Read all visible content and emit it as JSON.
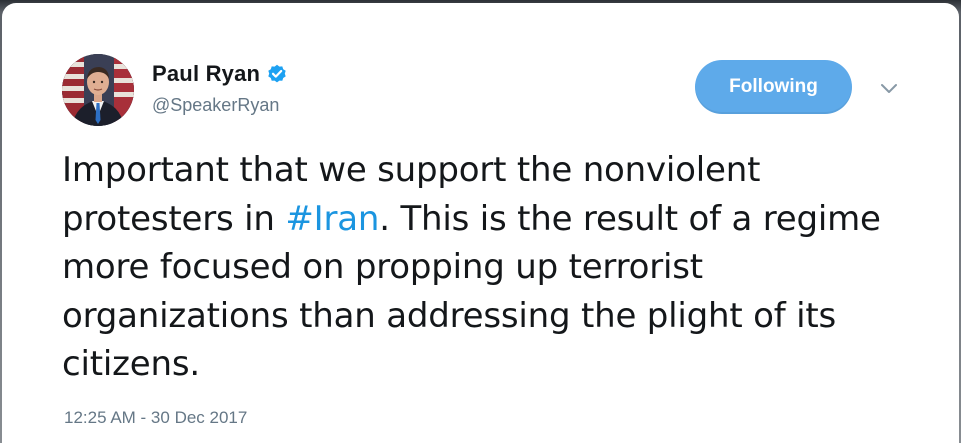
{
  "tweet": {
    "author": {
      "display_name": "Paul Ryan",
      "handle": "@SpeakerRyan",
      "verified": true,
      "avatar_icon": "profile-photo"
    },
    "follow_button_label": "Following",
    "menu_icon": "chevron-down-icon",
    "text_before_hashtag": "Important that we support the nonviolent protesters in ",
    "hashtag": "#Iran",
    "text_after_hashtag": ". This is the result of a regime more focused on propping up terrorist organizations than addressing the plight of its citizens.",
    "timestamp": "12:25 AM - 30 Dec 2017"
  },
  "colors": {
    "accent": "#1b95e0",
    "button_bg": "#5eaaea",
    "secondary_text": "#657786",
    "primary_text": "#14171a"
  }
}
